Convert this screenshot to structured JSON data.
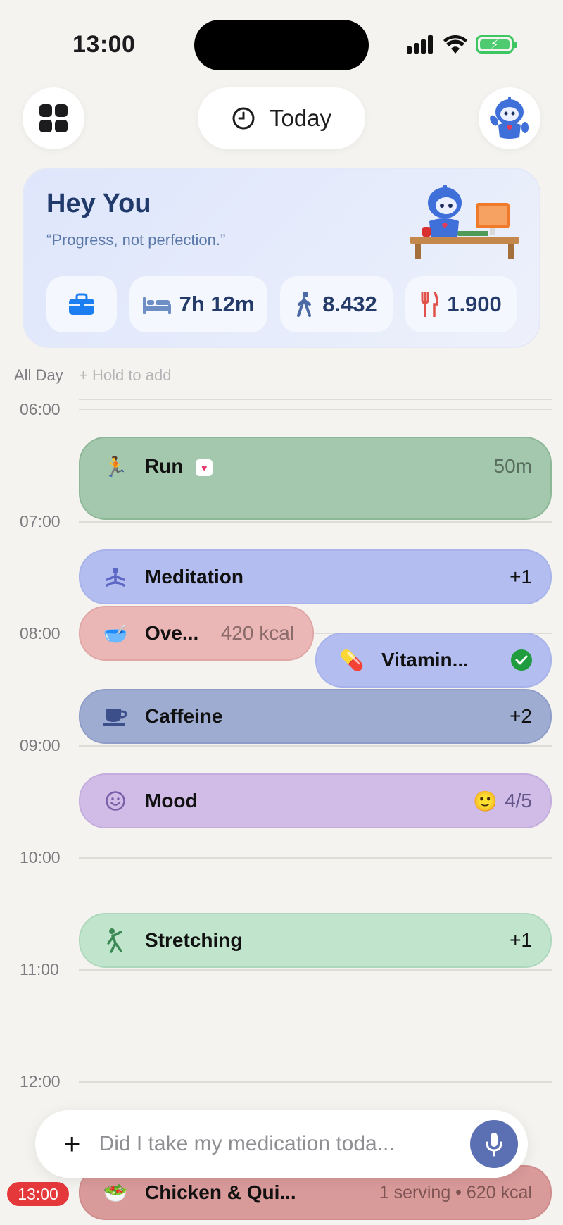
{
  "status": {
    "time": "13:00"
  },
  "top": {
    "today_label": "Today"
  },
  "hero": {
    "title": "Hey You",
    "quote": "“Progress, not perfection.”",
    "sleep": "7h 12m",
    "steps": "8.432",
    "calories": "1.900"
  },
  "allday": {
    "label": "All Day",
    "hint": "+ Hold to add"
  },
  "timeline": {
    "hours": [
      "06:00",
      "07:00",
      "08:00",
      "09:00",
      "10:00",
      "11:00",
      "12:00"
    ],
    "events": {
      "run": {
        "name": "Run",
        "meta": "50m"
      },
      "meditation": {
        "name": "Meditation",
        "meta": "+1"
      },
      "oatmeal": {
        "name": "Ove...",
        "meta": "420 kcal"
      },
      "vitamin": {
        "name": "Vitamin..."
      },
      "caffeine": {
        "name": "Caffeine",
        "meta": "+2"
      },
      "mood": {
        "name": "Mood",
        "meta": "4/5"
      },
      "stretching": {
        "name": "Stretching",
        "meta": "+1"
      },
      "chicken": {
        "name": "Chicken & Qui...",
        "meta": "1 serving • 620 kcal"
      }
    },
    "now": "13:00"
  },
  "input": {
    "placeholder": "Did I take my medication toda..."
  }
}
